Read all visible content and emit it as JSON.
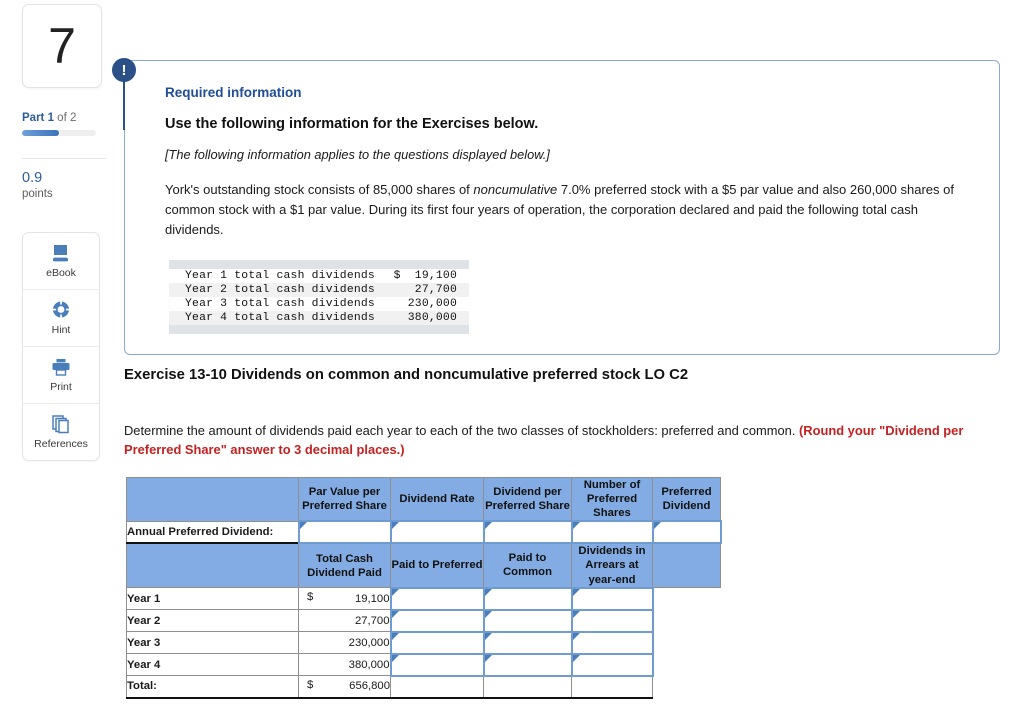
{
  "left_rail": {
    "question_number": "7",
    "part_prefix": "Part ",
    "part_current": "1",
    "part_suffix": " of 2",
    "points_value": "0.9",
    "points_label": "points",
    "tools": [
      {
        "label": "eBook",
        "icon": "book-icon"
      },
      {
        "label": "Hint",
        "icon": "life-ring-icon"
      },
      {
        "label": "Print",
        "icon": "printer-icon"
      },
      {
        "label": "References",
        "icon": "copy-pages-icon"
      }
    ]
  },
  "required_info": {
    "alert_glyph": "!",
    "kicker": "Required information",
    "heading": "Use the following information for the Exercises below.",
    "italic_note": "[The following information applies to the questions displayed below.]",
    "body_part1": "York's outstanding stock consists of 85,000 shares of ",
    "body_emphasis": "noncumulative",
    "body_part2": " 7.0% preferred stock with a $5 par value and also 260,000 shares of common stock with a $1 par value. During its first four years of operation, the corporation declared and paid the following total cash dividends.",
    "dividend_lines": [
      {
        "label": "Year 1 total cash dividends",
        "currency": "$",
        "amount": " 19,100"
      },
      {
        "label": "Year 2 total cash dividends",
        "currency": "",
        "amount": " 27,700"
      },
      {
        "label": "Year 3 total cash dividends",
        "currency": "",
        "amount": "230,000"
      },
      {
        "label": "Year 4 total cash dividends",
        "currency": "",
        "amount": "380,000"
      }
    ]
  },
  "exercise": {
    "title": "Exercise 13-10 Dividends on common and noncumulative preferred stock LO C2",
    "instruction_normal": "Determine the amount of dividends paid each year to each of the two classes of stockholders: preferred and common. ",
    "instruction_warning": "(Round your \"Dividend per Preferred Share\" answer to 3 decimal places.)"
  },
  "answer_table": {
    "header_top": [
      "",
      "Par Value per Preferred Share",
      "Dividend Rate",
      "Dividend per Preferred Share",
      "Number of Preferred Shares",
      "Preferred Dividend"
    ],
    "annual_row_label": "Annual Preferred Dividend:",
    "header_second": [
      "",
      "Total Cash Dividend Paid",
      "Paid to Preferred",
      "Paid to Common",
      "Dividends in Arrears at year-end",
      ""
    ],
    "rows": [
      {
        "label": "Year 1",
        "currency": "$",
        "total": "19,100"
      },
      {
        "label": "Year 2",
        "currency": "",
        "total": "27,700"
      },
      {
        "label": "Year 3",
        "currency": "",
        "total": "230,000"
      },
      {
        "label": "Year 4",
        "currency": "",
        "total": "380,000"
      }
    ],
    "total_row": {
      "label": "Total:",
      "currency": "$",
      "total": "656,800"
    }
  },
  "colors": {
    "header_blue": "#82ace3",
    "accent_navy": "#2b5088",
    "link_blue": "#1f4e96",
    "warning_red": "#c42121",
    "input_border": "#6f9bd1"
  }
}
